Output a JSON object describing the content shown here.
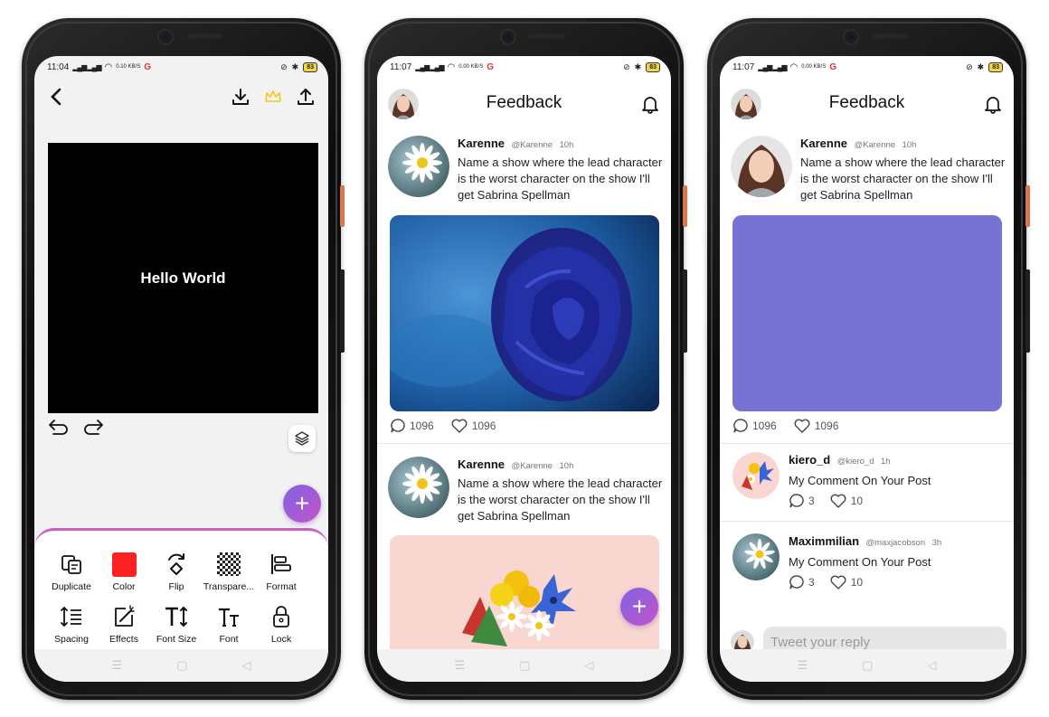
{
  "phones": [
    {
      "status": {
        "time": "11:04",
        "net": "0.10 KB/S",
        "g": "G",
        "battery": "83"
      },
      "editor": {
        "canvas_text": "Hello World",
        "back_label": "<",
        "tools": [
          {
            "label": "Duplicate",
            "icon": "duplicate-icon"
          },
          {
            "label": "Color",
            "icon": "color-swatch-icon"
          },
          {
            "label": "Flip",
            "icon": "flip-icon"
          },
          {
            "label": "Transpare...",
            "icon": "transparency-icon"
          },
          {
            "label": "Format",
            "icon": "format-icon"
          },
          {
            "label": "Spacing",
            "icon": "spacing-icon"
          },
          {
            "label": "Effects",
            "icon": "effects-icon"
          },
          {
            "label": "Font Size",
            "icon": "font-size-icon"
          },
          {
            "label": "Font",
            "icon": "font-icon"
          },
          {
            "label": "Lock",
            "icon": "lock-icon"
          }
        ],
        "swatch_color": "#ff2121",
        "crown_color": "#f5c518",
        "fab_label": "+"
      }
    },
    {
      "status": {
        "time": "11:07",
        "net": "0.00 KB/S",
        "g": "G",
        "battery": "83"
      },
      "header_title": "Feedback",
      "posts": [
        {
          "name": "Karenne",
          "handle": "@Karenne",
          "time": "10h",
          "body": "Name a show where the lead character is the worst character on the show I'll get Sabrina Spellman",
          "comments": "1096",
          "likes": "1096"
        },
        {
          "name": "Karenne",
          "handle": "@Karenne",
          "time": "10h",
          "body": "Name a show where the lead character is the worst character on the show I'll get Sabrina Spellman"
        }
      ],
      "fab_label": "+"
    },
    {
      "status": {
        "time": "11:07",
        "net": "0.00 KB/S",
        "g": "G",
        "battery": "83"
      },
      "header_title": "Feedback",
      "post": {
        "name": "Karenne",
        "handle": "@Karenne",
        "time": "10h",
        "body": "Name a show where the lead character is the worst character on the show I'll get Sabrina Spellman",
        "comments": "1096",
        "likes": "1096",
        "media_color": "#7773d4"
      },
      "comments": [
        {
          "name": "kiero_d",
          "handle": "@kiero_d",
          "time": "1h",
          "body": "My Comment On Your Post",
          "replies": "3",
          "likes": "10"
        },
        {
          "name": "Maximmilian",
          "handle": "@maxjacobson",
          "time": "3h",
          "body": "My Comment On Your Post",
          "replies": "3",
          "likes": "10"
        }
      ],
      "reply_placeholder": "Tweet your reply"
    }
  ],
  "nav": {
    "menu": "☰",
    "home": "▢",
    "back": "◁"
  }
}
